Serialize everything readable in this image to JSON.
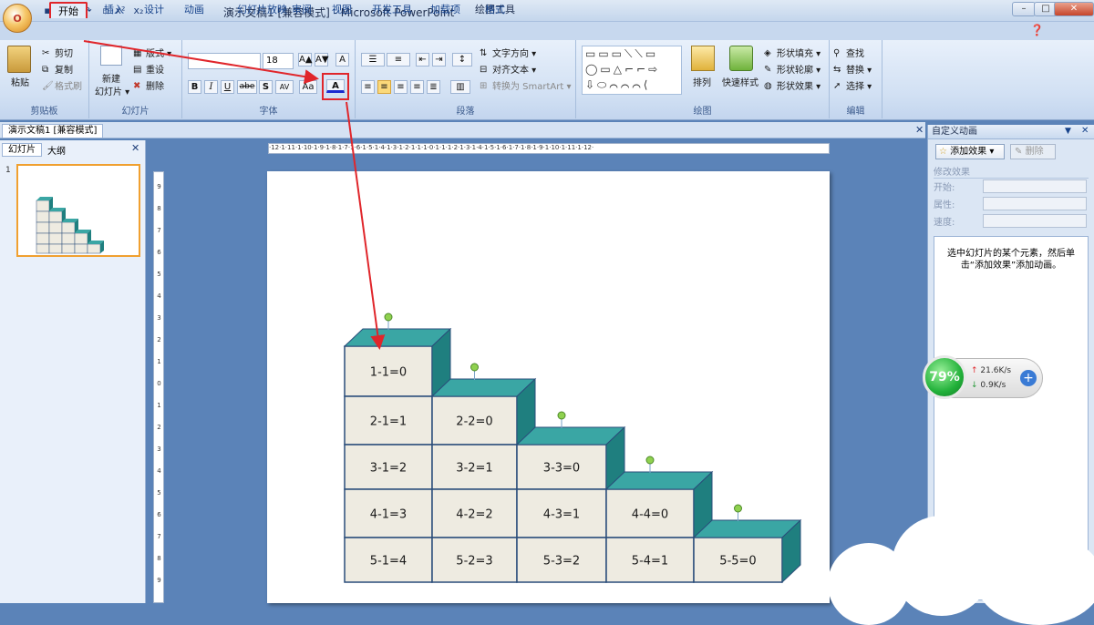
{
  "titlebar": {
    "doc_title": "演示文稿1 [兼容模式] - Microsoft PowerPoint",
    "context_tab": "绘图工具",
    "office_letter": "O",
    "undo_glyph": "↶",
    "redo_glyph": "↷",
    "super_glyph": "x²",
    "sub_glyph": "x₂"
  },
  "tabs": [
    "开始",
    "插入",
    "设计",
    "动画",
    "幻灯片放映",
    "审阅",
    "视图",
    "开发工具",
    "加载项",
    "格式"
  ],
  "groups": {
    "clipboard": {
      "label": "剪贴板",
      "paste": "粘贴",
      "cut": "剪切",
      "copy": "复制",
      "format_painter": "格式刷"
    },
    "slides": {
      "label": "幻灯片",
      "new_slide": "新建",
      "new_slide2": "幻灯片 ▾",
      "layout": "版式 ▾",
      "reset": "重设",
      "delete": "删除"
    },
    "font": {
      "label": "字体",
      "font_size": "18",
      "bold": "B",
      "italic": "I",
      "underline": "U",
      "strike": "abe",
      "shadow": "S",
      "spacing": "AV",
      "case": "Aa",
      "color": "A",
      "grow": "A▲",
      "shrink": "A▼",
      "clear": "A"
    },
    "paragraph": {
      "label": "段落",
      "text_direction": "文字方向 ▾",
      "align_text": "对齐文本 ▾",
      "smartart": "转换为 SmartArt ▾"
    },
    "drawing": {
      "label": "绘图",
      "arrange": "排列",
      "quick_styles": "快速样式",
      "fill": "形状填充 ▾",
      "outline": "形状轮廓 ▾",
      "effects": "形状效果 ▾"
    },
    "editing": {
      "label": "编辑",
      "find": "查找",
      "replace": "替换 ▾",
      "select": "选择 ▾"
    }
  },
  "doc_tab": "演示文稿1 [兼容模式]",
  "slides_panel": {
    "tab_slides": "幻灯片",
    "tab_outline": "大纲",
    "slide_number": "1"
  },
  "ruler_h": "·12·1·11·1·10·1·9·1·8·1·7·1·6·1·5·1·4·1·3·1·2·1·1·1·0·1·1·1·2·1·3·1·4·1·5·1·6·1·7·1·8·1·9·1·10·1·11·1·12·",
  "ruler_v_digits": [
    "9",
    "8",
    "7",
    "6",
    "5",
    "4",
    "3",
    "2",
    "1",
    "0",
    "1",
    "2",
    "3",
    "4",
    "5",
    "6",
    "7",
    "8",
    "9"
  ],
  "anim_pane": {
    "title": "自定义动画",
    "add_effect": "添加效果 ▾",
    "remove": "删除",
    "modify": "修改效果",
    "start": "开始:",
    "property": "属性:",
    "speed": "速度:",
    "hint": "选中幻灯片的某个元素，然后单击“添加效果”添加动画。"
  },
  "net_widget": {
    "percent": "79%",
    "up": "21.6K/s",
    "down": "0.9K/s"
  },
  "stairs": [
    [
      "1-1=0"
    ],
    [
      "2-1=1",
      "2-2=0"
    ],
    [
      "3-1=2",
      "3-2=1",
      "3-3=0"
    ],
    [
      "4-1=3",
      "4-2=2",
      "4-3=1",
      "4-4=0"
    ],
    [
      "5-1=4",
      "5-2=3",
      "5-3=2",
      "5-4=1",
      "5-5=0"
    ]
  ],
  "colors": {
    "box_face": "#eeebe1",
    "box_top": "#3aa6a4",
    "box_side": "#1f7f7f",
    "box_border": "#2a4d7a",
    "highlight": "#e0262b"
  }
}
